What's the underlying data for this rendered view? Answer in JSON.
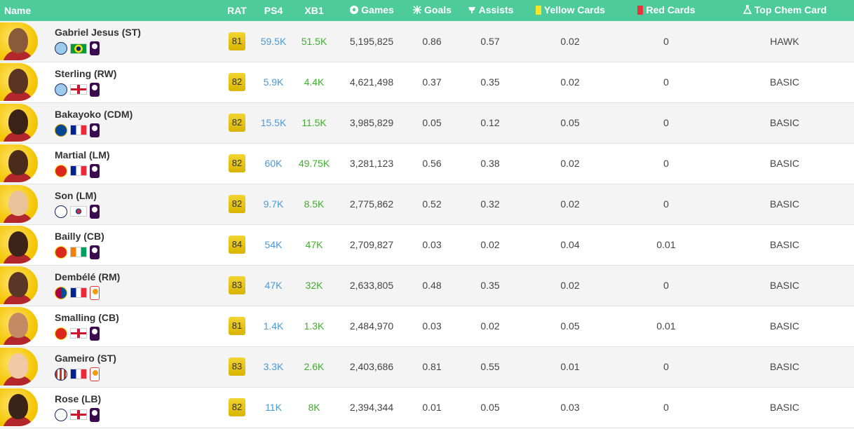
{
  "headers": {
    "name": "Name",
    "rat": "RAT",
    "ps4": "PS4",
    "xb1": "XB1",
    "games": "Games",
    "goals": "Goals",
    "assists": "Assists",
    "yellow": "Yellow Cards",
    "red": "Red Cards",
    "chem": "Top Chem Card"
  },
  "colors": {
    "header_bg": "#4ecb9b",
    "rating_gold": "#e2c300",
    "ps4_blue": "#4a9ad4",
    "xb1_green": "#3fae2a"
  },
  "players": [
    {
      "name": "Gabriel Jesus (ST)",
      "rat": "81",
      "ps4": "59.5K",
      "xb1": "51.5K",
      "games": "5,195,825",
      "goals": "0.86",
      "assists": "0.57",
      "yellow": "0.02",
      "red": "0",
      "chem": "HAWK",
      "club": "man-city-crest",
      "nation": "brazil-flag",
      "league": "premier-league-logo"
    },
    {
      "name": "Sterling (RW)",
      "rat": "82",
      "ps4": "5.9K",
      "xb1": "4.4K",
      "games": "4,621,498",
      "goals": "0.37",
      "assists": "0.35",
      "yellow": "0.02",
      "red": "0",
      "chem": "BASIC",
      "club": "man-city-crest",
      "nation": "england-flag",
      "league": "premier-league-logo"
    },
    {
      "name": "Bakayoko (CDM)",
      "rat": "82",
      "ps4": "15.5K",
      "xb1": "11.5K",
      "games": "3,985,829",
      "goals": "0.05",
      "assists": "0.12",
      "yellow": "0.05",
      "red": "0",
      "chem": "BASIC",
      "club": "chelsea-crest",
      "nation": "france-flag",
      "league": "premier-league-logo"
    },
    {
      "name": "Martial (LM)",
      "rat": "82",
      "ps4": "60K",
      "xb1": "49.75K",
      "games": "3,281,123",
      "goals": "0.56",
      "assists": "0.38",
      "yellow": "0.02",
      "red": "0",
      "chem": "BASIC",
      "club": "man-united-crest",
      "nation": "france-flag",
      "league": "premier-league-logo"
    },
    {
      "name": "Son (LM)",
      "rat": "82",
      "ps4": "9.7K",
      "xb1": "8.5K",
      "games": "2,775,862",
      "goals": "0.52",
      "assists": "0.32",
      "yellow": "0.02",
      "red": "0",
      "chem": "BASIC",
      "club": "tottenham-crest",
      "nation": "south-korea-flag",
      "league": "premier-league-logo"
    },
    {
      "name": "Bailly (CB)",
      "rat": "84",
      "ps4": "54K",
      "xb1": "47K",
      "games": "2,709,827",
      "goals": "0.03",
      "assists": "0.02",
      "yellow": "0.04",
      "red": "0.01",
      "chem": "BASIC",
      "club": "man-united-crest",
      "nation": "ivory-coast-flag",
      "league": "premier-league-logo"
    },
    {
      "name": "Dembélé (RM)",
      "rat": "83",
      "ps4": "47K",
      "xb1": "32K",
      "games": "2,633,805",
      "goals": "0.48",
      "assists": "0.35",
      "yellow": "0.02",
      "red": "0",
      "chem": "BASIC",
      "club": "barcelona-crest",
      "nation": "france-flag",
      "league": "laliga-logo"
    },
    {
      "name": "Smalling (CB)",
      "rat": "81",
      "ps4": "1.4K",
      "xb1": "1.3K",
      "games": "2,484,970",
      "goals": "0.03",
      "assists": "0.02",
      "yellow": "0.05",
      "red": "0.01",
      "chem": "BASIC",
      "club": "man-united-crest",
      "nation": "england-flag",
      "league": "premier-league-logo"
    },
    {
      "name": "Gameiro (ST)",
      "rat": "83",
      "ps4": "3.3K",
      "xb1": "2.6K",
      "games": "2,403,686",
      "goals": "0.81",
      "assists": "0.55",
      "yellow": "0.01",
      "red": "0",
      "chem": "BASIC",
      "club": "atletico-madrid-crest",
      "nation": "france-flag",
      "league": "laliga-logo"
    },
    {
      "name": "Rose (LB)",
      "rat": "82",
      "ps4": "11K",
      "xb1": "8K",
      "games": "2,394,344",
      "goals": "0.01",
      "assists": "0.05",
      "yellow": "0.03",
      "red": "0",
      "chem": "BASIC",
      "club": "tottenham-crest",
      "nation": "england-flag",
      "league": "premier-league-logo"
    }
  ]
}
